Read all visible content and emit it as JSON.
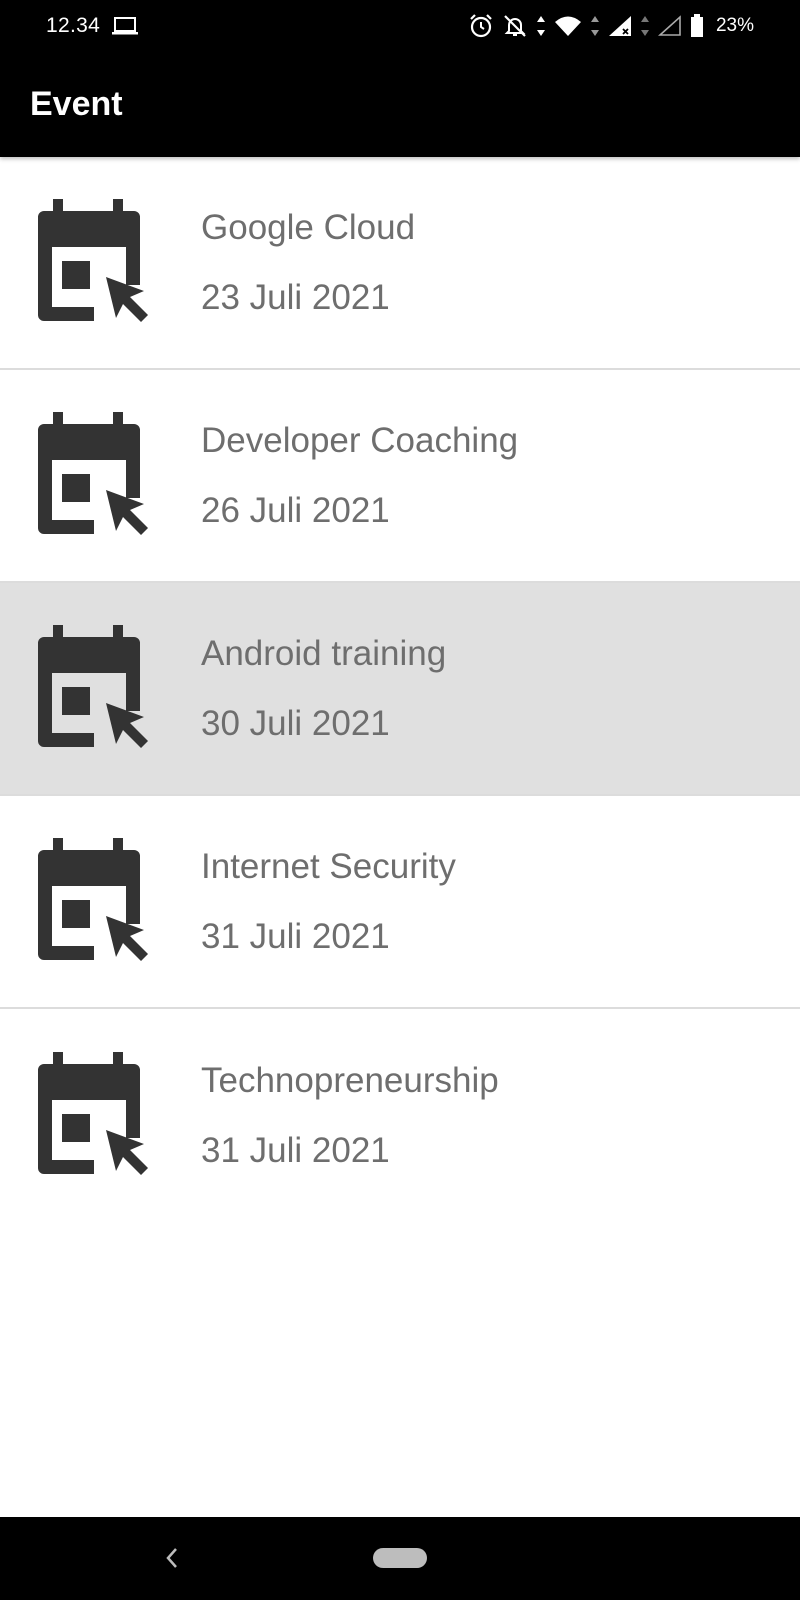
{
  "status_bar": {
    "time": "12.34",
    "battery": "23%",
    "icons": [
      "laptop-icon",
      "alarm-icon",
      "notifications-off-icon",
      "data-arrows-icon",
      "wifi-icon",
      "signal-icon",
      "signal-empty-icon",
      "battery-icon"
    ]
  },
  "app_bar": {
    "title": "Event"
  },
  "events": [
    {
      "name": "Google Cloud",
      "date": "23 Juli 2021",
      "icon": "event-calendar-icon"
    },
    {
      "name": "Developer Coaching",
      "date": "26 Juli 2021",
      "icon": "event-calendar-icon"
    },
    {
      "name": "Android training",
      "date": "30 Juli 2021",
      "icon": "event-calendar-icon",
      "selected": true
    },
    {
      "name": "Internet Security",
      "date": "31 Juli 2021",
      "icon": "event-calendar-icon"
    },
    {
      "name": "Technopreneurship",
      "date": "31 Juli 2021",
      "icon": "event-calendar-icon"
    }
  ],
  "nav_bar": {
    "buttons": [
      "back-icon",
      "home-pill-icon"
    ]
  },
  "colors": {
    "bar_background": "#000000",
    "text_secondary": "#6e6e6e",
    "icon": "#333333",
    "selected_row": "#e0e0e0",
    "divider": "#dcdcdc"
  }
}
